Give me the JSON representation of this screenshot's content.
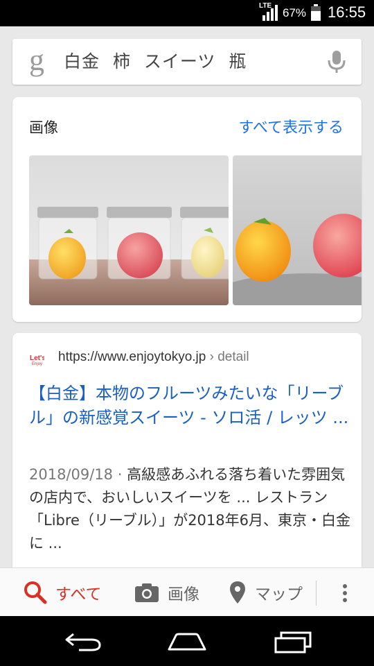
{
  "status_bar": {
    "network": "LTE",
    "battery_percent": "67%",
    "battery_level": 0.67,
    "time": "16:55"
  },
  "search": {
    "logo": "g",
    "query": "白金 柿 スイーツ 瓶",
    "mic_icon": "microphone-icon"
  },
  "images_section": {
    "title": "画像",
    "see_all": "すべて表示する"
  },
  "result": {
    "url": "https://www.enjoytokyo.jp",
    "breadcrumb": "› detail",
    "title": "【白金】本物のフルーツみたいな「リーブル」の新感覚スイーツ - ソロ活 / レッツ ...",
    "date": "2018/09/18 ·",
    "snippet": "高級感あふれる落ち着いた雰囲気の店内で、おいしいスイーツを ... レストラン「Libre（リーブル）」が2018年6月、東京・白金に ..."
  },
  "bottom_tabs": {
    "all": "すべて",
    "images": "画像",
    "maps": "マップ"
  },
  "colors": {
    "accent_blue": "#1a73e8",
    "link_blue": "#1a5fc4",
    "active_tab_red": "#d93025"
  }
}
